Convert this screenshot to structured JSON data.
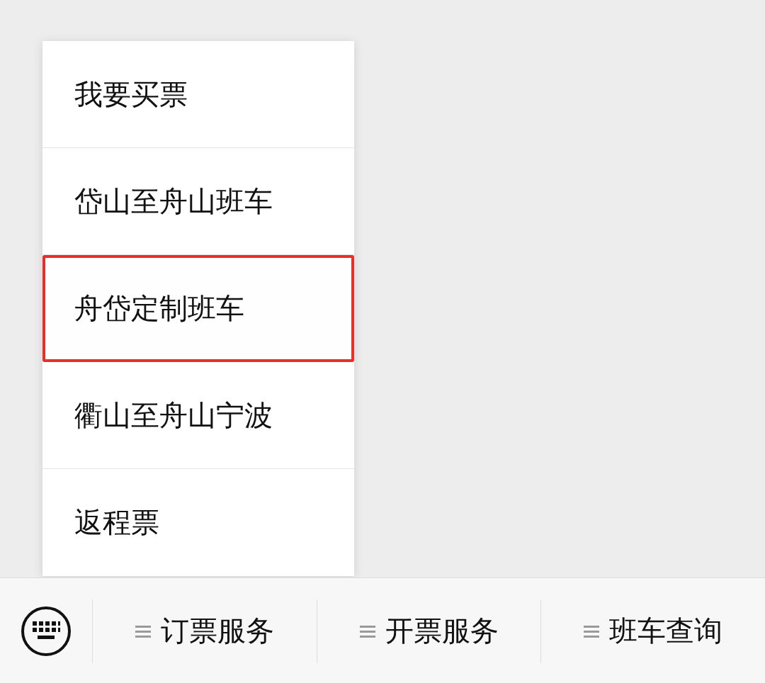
{
  "menu": {
    "items": [
      {
        "label": "我要买票",
        "selected": false
      },
      {
        "label": "岱山至舟山班车",
        "selected": false
      },
      {
        "label": "舟岱定制班车",
        "selected": true
      },
      {
        "label": "衢山至舟山宁波",
        "selected": false
      },
      {
        "label": "返程票",
        "selected": false
      }
    ]
  },
  "bottom_bar": {
    "menus": [
      {
        "label": "订票服务"
      },
      {
        "label": "开票服务"
      },
      {
        "label": "班车查询"
      }
    ]
  }
}
